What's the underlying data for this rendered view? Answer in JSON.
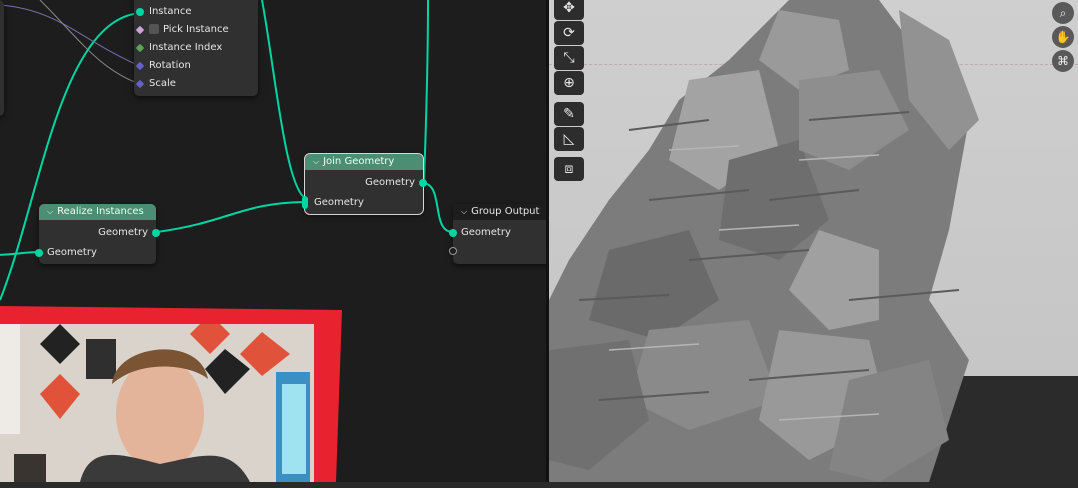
{
  "nodes": {
    "instance_node": {
      "rows": {
        "instance": "Instance",
        "pick_instance": "Pick Instance",
        "instance_index": "Instance Index",
        "rotation": "Rotation",
        "scale": "Scale"
      }
    },
    "join_geometry": {
      "title": "Join Geometry",
      "output": "Geometry",
      "input": "Geometry"
    },
    "realize_instances": {
      "title": "Realize Instances",
      "output": "Geometry",
      "input": "Geometry"
    },
    "group_output": {
      "title": "Group Output",
      "input": "Geometry"
    }
  },
  "viewport": {
    "toolbar": [
      {
        "icon": "move-icon",
        "glyph": "✥"
      },
      {
        "icon": "rotate-icon",
        "glyph": "⟳"
      },
      {
        "icon": "scale-icon",
        "glyph": "⤡"
      },
      {
        "icon": "transform-icon",
        "glyph": "⊕"
      },
      {
        "icon": "annotate-icon",
        "glyph": "✎"
      },
      {
        "icon": "measure-icon",
        "glyph": "◺"
      },
      {
        "icon": "add-cube-icon",
        "glyph": "⧈"
      }
    ],
    "nav_buttons": [
      {
        "icon": "zoom-icon",
        "glyph": "⌕"
      },
      {
        "icon": "pan-hand-icon",
        "glyph": "✋"
      },
      {
        "icon": "camera-view-icon",
        "glyph": "⌘"
      }
    ]
  },
  "colors": {
    "geometry_socket": "#00d6a3",
    "node_header": "#4b8e74",
    "vector_socket": "#6363c7"
  }
}
